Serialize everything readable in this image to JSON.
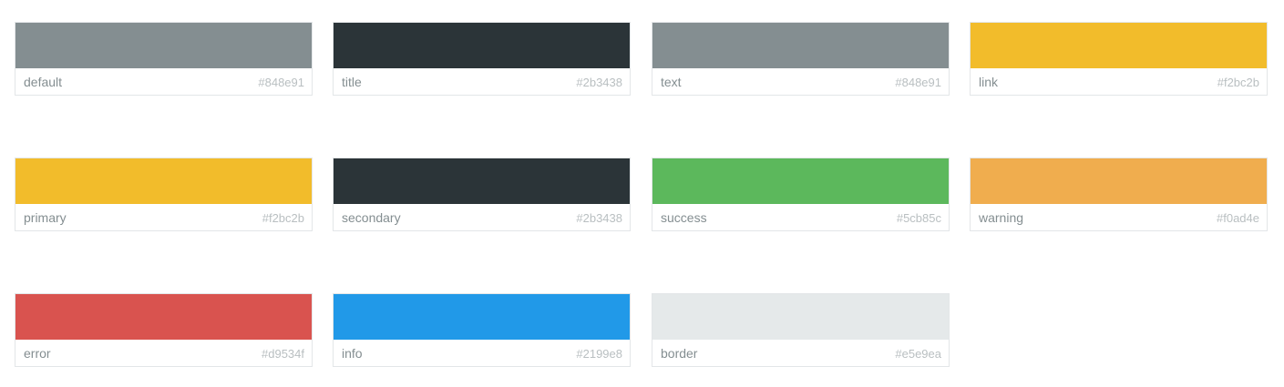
{
  "palette": {
    "colors": [
      {
        "name": "default",
        "hex": "#848e91"
      },
      {
        "name": "title",
        "hex": "#2b3438"
      },
      {
        "name": "text",
        "hex": "#848e91"
      },
      {
        "name": "link",
        "hex": "#f2bc2b"
      },
      {
        "name": "primary",
        "hex": "#f2bc2b"
      },
      {
        "name": "secondary",
        "hex": "#2b3438"
      },
      {
        "name": "success",
        "hex": "#5cb85c"
      },
      {
        "name": "warning",
        "hex": "#f0ad4e"
      },
      {
        "name": "error",
        "hex": "#d9534f"
      },
      {
        "name": "info",
        "hex": "#2199e8"
      },
      {
        "name": "border",
        "hex": "#e5e9ea"
      }
    ]
  }
}
